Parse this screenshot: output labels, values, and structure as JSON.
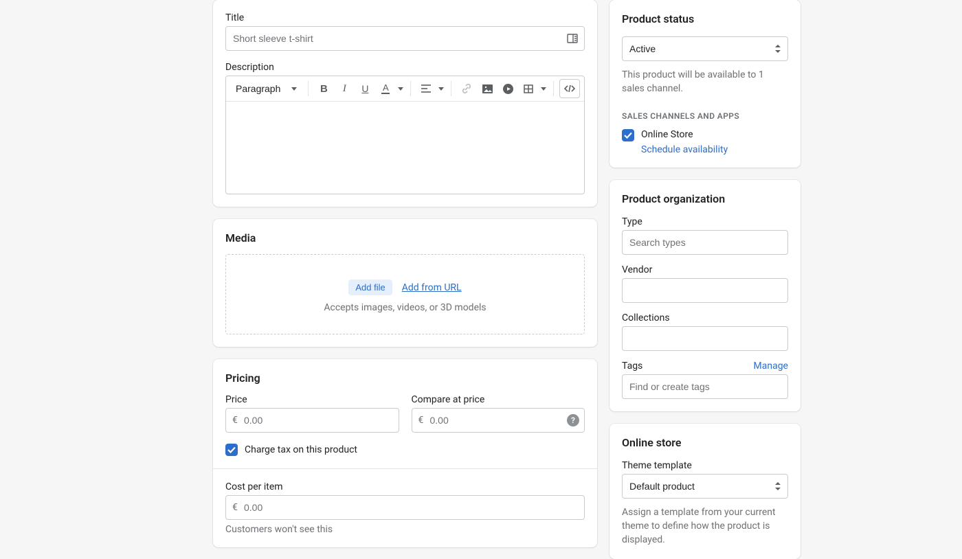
{
  "title_section": {
    "title_label": "Title",
    "title_placeholder": "Short sleeve t-shirt",
    "description_label": "Description",
    "paragraph_option": "Paragraph"
  },
  "media": {
    "heading": "Media",
    "add_file": "Add file",
    "add_from_url": "Add from URL",
    "hint": "Accepts images, videos, or 3D models"
  },
  "pricing": {
    "heading": "Pricing",
    "price_label": "Price",
    "compare_label": "Compare at price",
    "currency_prefix": "€",
    "price_placeholder": "0.00",
    "compare_placeholder": "0.00",
    "charge_tax": "Charge tax on this product",
    "cost_label": "Cost per item",
    "cost_placeholder": "0.00",
    "cost_hint": "Customers won't see this"
  },
  "status": {
    "heading": "Product status",
    "selected": "Active",
    "hint": "This product will be available to 1 sales channel.",
    "channels_heading": "SALES CHANNELS AND APPS",
    "channel_name": "Online Store",
    "schedule": "Schedule availability"
  },
  "organization": {
    "heading": "Product organization",
    "type_label": "Type",
    "type_placeholder": "Search types",
    "vendor_label": "Vendor",
    "collections_label": "Collections",
    "tags_label": "Tags",
    "manage": "Manage",
    "tags_placeholder": "Find or create tags"
  },
  "online_store": {
    "heading": "Online store",
    "template_label": "Theme template",
    "template_selected": "Default product",
    "hint": "Assign a template from your current theme to define how the product is displayed."
  }
}
